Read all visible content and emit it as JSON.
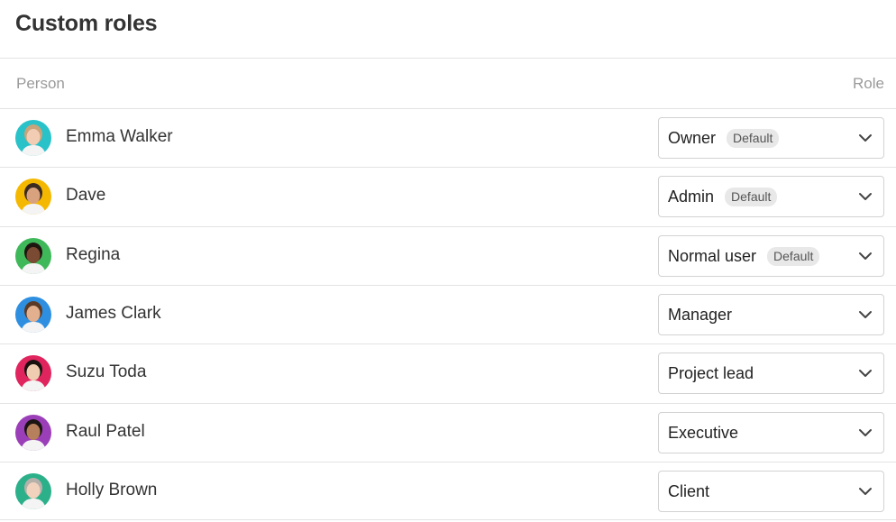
{
  "page": {
    "title": "Custom roles"
  },
  "table": {
    "headers": {
      "person": "Person",
      "role": "Role"
    },
    "rows": [
      {
        "name": "Emma Walker",
        "role": "Owner",
        "badge": "Default",
        "avatar_bg": "#29c2c9",
        "skin": "#f2cdb4",
        "hair": "#c9a37a"
      },
      {
        "name": "Dave",
        "role": "Admin",
        "badge": "Default",
        "avatar_bg": "#f5b800",
        "skin": "#d9a27f",
        "hair": "#3a2a20"
      },
      {
        "name": "Regina",
        "role": "Normal user",
        "badge": "Default",
        "avatar_bg": "#3fb85a",
        "skin": "#7a4a32",
        "hair": "#1e1410"
      },
      {
        "name": "James Clark",
        "role": "Manager",
        "badge": "",
        "avatar_bg": "#2e8fe0",
        "skin": "#e2b08f",
        "hair": "#5a3a26"
      },
      {
        "name": "Suzu Toda",
        "role": "Project lead",
        "badge": "",
        "avatar_bg": "#e0245e",
        "skin": "#f0cdb0",
        "hair": "#1a1210"
      },
      {
        "name": "Raul Patel",
        "role": "Executive",
        "badge": "",
        "avatar_bg": "#9b3fb8",
        "skin": "#b7805c",
        "hair": "#1a1412"
      },
      {
        "name": "Holly Brown",
        "role": "Client",
        "badge": "",
        "avatar_bg": "#2bb08a",
        "skin": "#f0d2bd",
        "hair": "#b5b0aa"
      }
    ]
  },
  "icons": {
    "select_chevron": "chevron-down-icon"
  }
}
